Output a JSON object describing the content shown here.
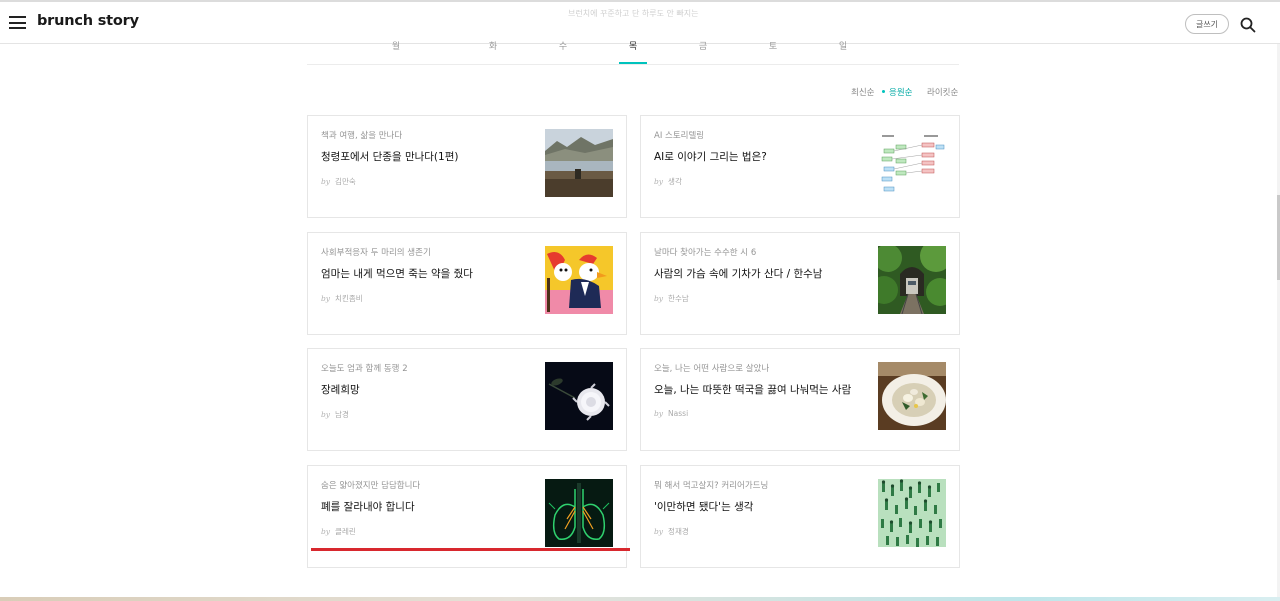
{
  "header": {
    "logo": "brunch story",
    "ghost_text": "브런치에 꾸준하고 단 하루도 안 빠지는",
    "write_label": "글쓰기"
  },
  "days": [
    "월",
    "화",
    "수",
    "목",
    "금",
    "토",
    "일"
  ],
  "active_day": "목",
  "sort": {
    "options": [
      "최신순",
      "응원순",
      "라이킷순"
    ],
    "active": "응원순"
  },
  "cards": [
    {
      "magazine": "책과 여행, 삶을 만나다",
      "title": "청령포에서 단종을 만나다(1편)",
      "by": "by",
      "author": "김만숙",
      "image": "riverside-landscape-photo"
    },
    {
      "magazine": "AI 스토리텔링",
      "title": "AI로 이야기 그리는 법은?",
      "by": "by",
      "author": "생각",
      "image": "flowchart-diagram"
    },
    {
      "magazine": "사회부적응자 두 마리의 생존기",
      "title": "엄마는 내게 먹으면 죽는 약을 줬다",
      "by": "by",
      "author": "치킨좀비",
      "image": "rooster-grim-reaper-illustration"
    },
    {
      "magazine": "날마다 찾아가는 수수한 시 6",
      "title": "사람의 가슴 속에 기차가 산다 / 한수남",
      "by": "by",
      "author": "한수남",
      "image": "forest-train-tunnel-photo"
    },
    {
      "magazine": "오늘도 엄과 함께 동행 2",
      "title": "장례희망",
      "by": "by",
      "author": "남경",
      "image": "white-chrysanthemum-photo"
    },
    {
      "magazine": "오늘, 나는 어떤 사람으로 살았나",
      "title": "오늘, 나는 따뜻한 떡국을 끓여 나눠먹는 사람",
      "by": "by",
      "author": "Nassi",
      "image": "rice-cake-soup-photo"
    },
    {
      "magazine": "숨은 얇아졌지만 담담합니다",
      "title": "폐를 잘라내야 합니다",
      "by": "by",
      "author": "클레린",
      "image": "lungs-xray-illustration"
    },
    {
      "magazine": "뭐 해서 먹고살지? 커리어가드닝",
      "title": "'이만하면 됐다'는 생각",
      "by": "by",
      "author": "정재경",
      "image": "crowd-figures-pattern"
    }
  ],
  "colors": {
    "accent": "#00c3bd",
    "highlight_underline": "#d8282e"
  }
}
